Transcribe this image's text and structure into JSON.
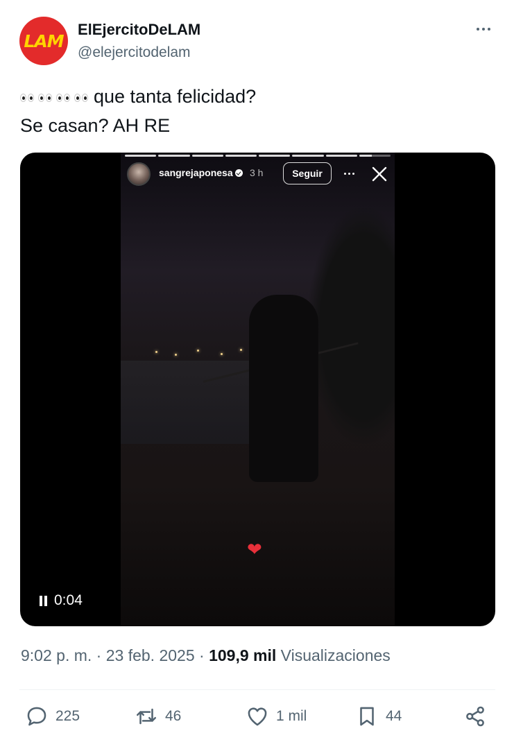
{
  "author": {
    "avatar_text": "LAM",
    "display_name": "ElEjercitoDeLAM",
    "handle": "@elejercitodelam"
  },
  "icons": {
    "more": "more-horizontal-icon",
    "eyes": "eyes-emoji-icon",
    "reply": "reply-icon",
    "retweet": "retweet-icon",
    "like": "heart-icon",
    "bookmark": "bookmark-icon",
    "share": "share-icon"
  },
  "tweet": {
    "line1": "que tanta felicidad?",
    "line2": "Se casan?  AH RE"
  },
  "story": {
    "username": "sangrejaponesa",
    "time": "3 h",
    "follow_label": "Seguir",
    "heart": "❤"
  },
  "video": {
    "elapsed": "0:04"
  },
  "meta": {
    "time": "9:02 p. m.",
    "sep1": " · ",
    "date": "23 feb. 2025",
    "sep2": " · ",
    "views_count": "109,9 mil",
    "views_label": " Visualizaciones"
  },
  "actions": {
    "replies": "225",
    "reposts": "46",
    "likes": "1 mil",
    "bookmarks": "44"
  },
  "colors": {
    "text": "#0f1419",
    "muted": "#536471",
    "avatar_bg": "#e32b2b",
    "avatar_text": "#ffd400"
  }
}
